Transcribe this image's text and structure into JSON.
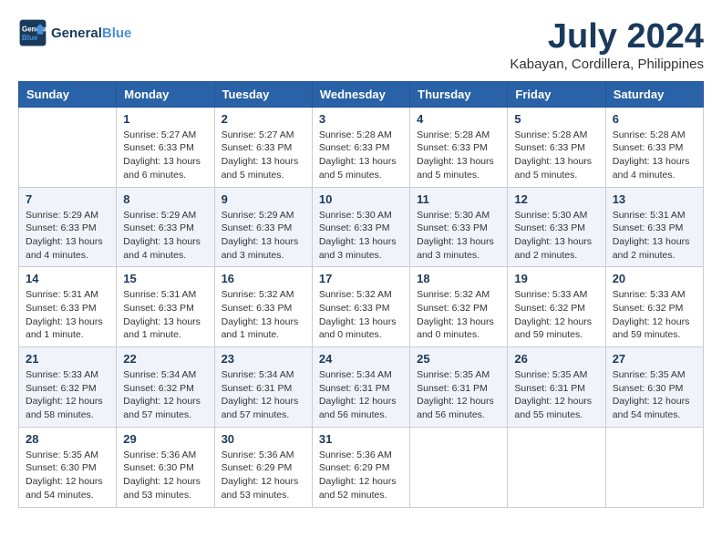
{
  "header": {
    "logo_line1": "General",
    "logo_line2": "Blue",
    "main_title": "July 2024",
    "subtitle": "Kabayan, Cordillera, Philippines"
  },
  "calendar": {
    "days_of_week": [
      "Sunday",
      "Monday",
      "Tuesday",
      "Wednesday",
      "Thursday",
      "Friday",
      "Saturday"
    ],
    "weeks": [
      [
        {
          "day": "",
          "sunrise": "",
          "sunset": "",
          "daylight": ""
        },
        {
          "day": "1",
          "sunrise": "Sunrise: 5:27 AM",
          "sunset": "Sunset: 6:33 PM",
          "daylight": "Daylight: 13 hours and 6 minutes."
        },
        {
          "day": "2",
          "sunrise": "Sunrise: 5:27 AM",
          "sunset": "Sunset: 6:33 PM",
          "daylight": "Daylight: 13 hours and 5 minutes."
        },
        {
          "day": "3",
          "sunrise": "Sunrise: 5:28 AM",
          "sunset": "Sunset: 6:33 PM",
          "daylight": "Daylight: 13 hours and 5 minutes."
        },
        {
          "day": "4",
          "sunrise": "Sunrise: 5:28 AM",
          "sunset": "Sunset: 6:33 PM",
          "daylight": "Daylight: 13 hours and 5 minutes."
        },
        {
          "day": "5",
          "sunrise": "Sunrise: 5:28 AM",
          "sunset": "Sunset: 6:33 PM",
          "daylight": "Daylight: 13 hours and 5 minutes."
        },
        {
          "day": "6",
          "sunrise": "Sunrise: 5:28 AM",
          "sunset": "Sunset: 6:33 PM",
          "daylight": "Daylight: 13 hours and 4 minutes."
        }
      ],
      [
        {
          "day": "7",
          "sunrise": "Sunrise: 5:29 AM",
          "sunset": "Sunset: 6:33 PM",
          "daylight": "Daylight: 13 hours and 4 minutes."
        },
        {
          "day": "8",
          "sunrise": "Sunrise: 5:29 AM",
          "sunset": "Sunset: 6:33 PM",
          "daylight": "Daylight: 13 hours and 4 minutes."
        },
        {
          "day": "9",
          "sunrise": "Sunrise: 5:29 AM",
          "sunset": "Sunset: 6:33 PM",
          "daylight": "Daylight: 13 hours and 3 minutes."
        },
        {
          "day": "10",
          "sunrise": "Sunrise: 5:30 AM",
          "sunset": "Sunset: 6:33 PM",
          "daylight": "Daylight: 13 hours and 3 minutes."
        },
        {
          "day": "11",
          "sunrise": "Sunrise: 5:30 AM",
          "sunset": "Sunset: 6:33 PM",
          "daylight": "Daylight: 13 hours and 3 minutes."
        },
        {
          "day": "12",
          "sunrise": "Sunrise: 5:30 AM",
          "sunset": "Sunset: 6:33 PM",
          "daylight": "Daylight: 13 hours and 2 minutes."
        },
        {
          "day": "13",
          "sunrise": "Sunrise: 5:31 AM",
          "sunset": "Sunset: 6:33 PM",
          "daylight": "Daylight: 13 hours and 2 minutes."
        }
      ],
      [
        {
          "day": "14",
          "sunrise": "Sunrise: 5:31 AM",
          "sunset": "Sunset: 6:33 PM",
          "daylight": "Daylight: 13 hours and 1 minute."
        },
        {
          "day": "15",
          "sunrise": "Sunrise: 5:31 AM",
          "sunset": "Sunset: 6:33 PM",
          "daylight": "Daylight: 13 hours and 1 minute."
        },
        {
          "day": "16",
          "sunrise": "Sunrise: 5:32 AM",
          "sunset": "Sunset: 6:33 PM",
          "daylight": "Daylight: 13 hours and 1 minute."
        },
        {
          "day": "17",
          "sunrise": "Sunrise: 5:32 AM",
          "sunset": "Sunset: 6:33 PM",
          "daylight": "Daylight: 13 hours and 0 minutes."
        },
        {
          "day": "18",
          "sunrise": "Sunrise: 5:32 AM",
          "sunset": "Sunset: 6:32 PM",
          "daylight": "Daylight: 13 hours and 0 minutes."
        },
        {
          "day": "19",
          "sunrise": "Sunrise: 5:33 AM",
          "sunset": "Sunset: 6:32 PM",
          "daylight": "Daylight: 12 hours and 59 minutes."
        },
        {
          "day": "20",
          "sunrise": "Sunrise: 5:33 AM",
          "sunset": "Sunset: 6:32 PM",
          "daylight": "Daylight: 12 hours and 59 minutes."
        }
      ],
      [
        {
          "day": "21",
          "sunrise": "Sunrise: 5:33 AM",
          "sunset": "Sunset: 6:32 PM",
          "daylight": "Daylight: 12 hours and 58 minutes."
        },
        {
          "day": "22",
          "sunrise": "Sunrise: 5:34 AM",
          "sunset": "Sunset: 6:32 PM",
          "daylight": "Daylight: 12 hours and 57 minutes."
        },
        {
          "day": "23",
          "sunrise": "Sunrise: 5:34 AM",
          "sunset": "Sunset: 6:31 PM",
          "daylight": "Daylight: 12 hours and 57 minutes."
        },
        {
          "day": "24",
          "sunrise": "Sunrise: 5:34 AM",
          "sunset": "Sunset: 6:31 PM",
          "daylight": "Daylight: 12 hours and 56 minutes."
        },
        {
          "day": "25",
          "sunrise": "Sunrise: 5:35 AM",
          "sunset": "Sunset: 6:31 PM",
          "daylight": "Daylight: 12 hours and 56 minutes."
        },
        {
          "day": "26",
          "sunrise": "Sunrise: 5:35 AM",
          "sunset": "Sunset: 6:31 PM",
          "daylight": "Daylight: 12 hours and 55 minutes."
        },
        {
          "day": "27",
          "sunrise": "Sunrise: 5:35 AM",
          "sunset": "Sunset: 6:30 PM",
          "daylight": "Daylight: 12 hours and 54 minutes."
        }
      ],
      [
        {
          "day": "28",
          "sunrise": "Sunrise: 5:35 AM",
          "sunset": "Sunset: 6:30 PM",
          "daylight": "Daylight: 12 hours and 54 minutes."
        },
        {
          "day": "29",
          "sunrise": "Sunrise: 5:36 AM",
          "sunset": "Sunset: 6:30 PM",
          "daylight": "Daylight: 12 hours and 53 minutes."
        },
        {
          "day": "30",
          "sunrise": "Sunrise: 5:36 AM",
          "sunset": "Sunset: 6:29 PM",
          "daylight": "Daylight: 12 hours and 53 minutes."
        },
        {
          "day": "31",
          "sunrise": "Sunrise: 5:36 AM",
          "sunset": "Sunset: 6:29 PM",
          "daylight": "Daylight: 12 hours and 52 minutes."
        },
        {
          "day": "",
          "sunrise": "",
          "sunset": "",
          "daylight": ""
        },
        {
          "day": "",
          "sunrise": "",
          "sunset": "",
          "daylight": ""
        },
        {
          "day": "",
          "sunrise": "",
          "sunset": "",
          "daylight": ""
        }
      ]
    ]
  }
}
